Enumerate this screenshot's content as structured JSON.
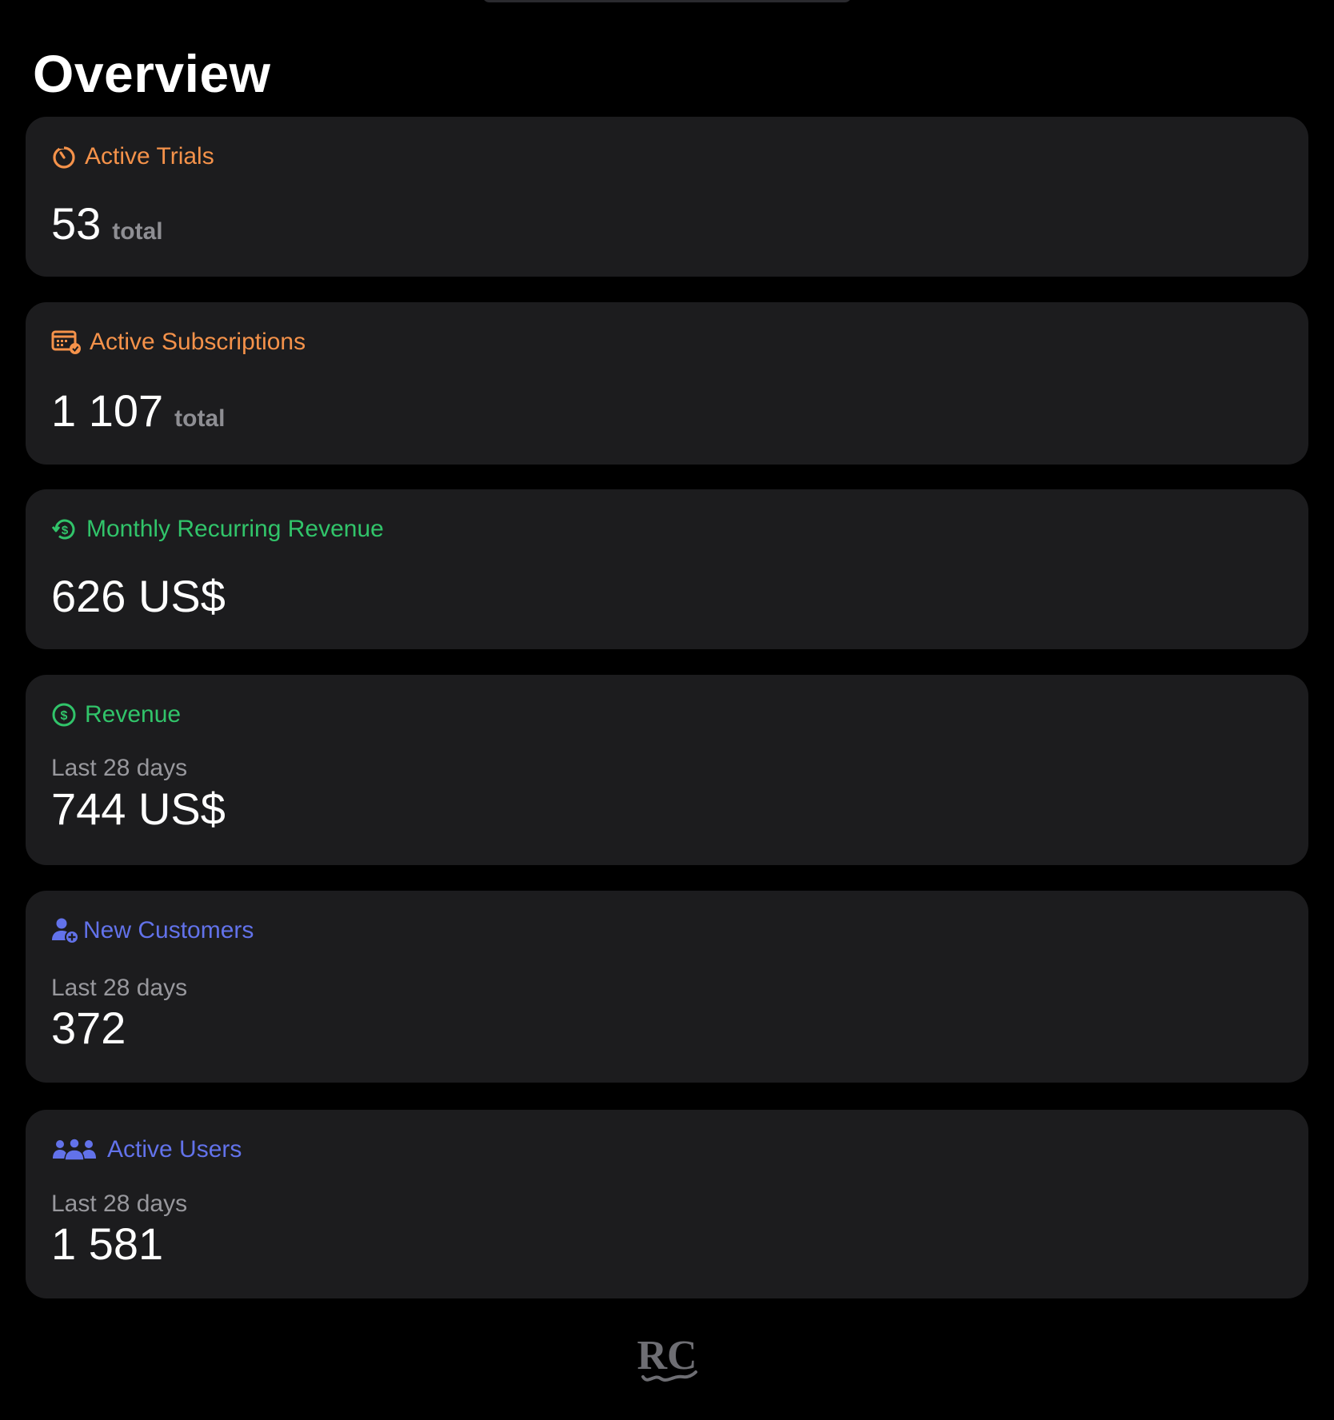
{
  "page": {
    "title": "Overview"
  },
  "colors": {
    "orange": "#f5924a",
    "green": "#31c46a",
    "blue": "#6272ea",
    "card_bg": "#1c1c1e",
    "page_bg": "#000000"
  },
  "cards": [
    {
      "id": "active-trials",
      "icon": "timer-icon",
      "title": "Active Trials",
      "value": "53",
      "unit": "total"
    },
    {
      "id": "active-subscriptions",
      "icon": "subscriptions-calendar-icon",
      "title": "Active Subscriptions",
      "value": "1 107",
      "unit": "total"
    },
    {
      "id": "monthly-recurring-revenue",
      "icon": "recurring-dollar-icon",
      "title": "Monthly Recurring Revenue",
      "value": "626 US$"
    },
    {
      "id": "revenue",
      "icon": "dollar-circle-icon",
      "title": "Revenue",
      "subtitle": "Last 28 days",
      "value": "744 US$"
    },
    {
      "id": "new-customers",
      "icon": "person-add-icon",
      "title": "New Customers",
      "subtitle": "Last 28 days",
      "value": "372"
    },
    {
      "id": "active-users",
      "icon": "people-group-icon",
      "title": "Active Users",
      "subtitle": "Last 28 days",
      "value": "1 581"
    }
  ],
  "footer": {
    "logo_icon": "revenuecat-logo-icon",
    "logo_text": "RC"
  }
}
